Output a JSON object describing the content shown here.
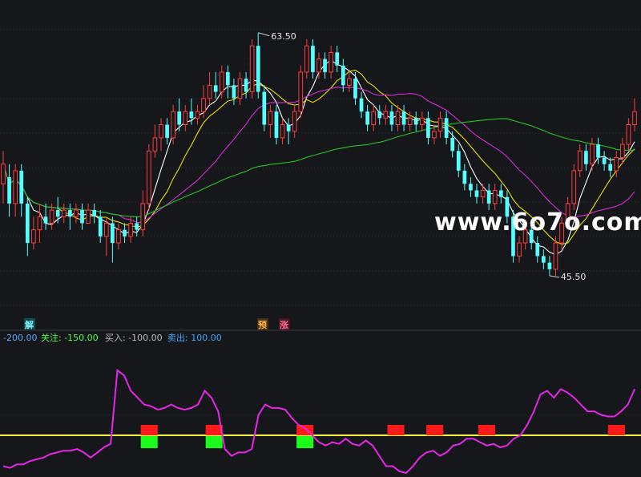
{
  "chart_data": [
    {
      "type": "candlestick",
      "panel": "price",
      "ylim": [
        43,
        66
      ],
      "grid": true,
      "annotations": {
        "high_label": "63.50",
        "low_label": "45.50"
      },
      "badges": [
        "解",
        "预",
        "涨"
      ],
      "watermark": "www.6o7o.com",
      "candles": [
        [
          52.5,
          54,
          55,
          51
        ],
        [
          53,
          51,
          54,
          50
        ],
        [
          51,
          53.5,
          54,
          50
        ],
        [
          53.5,
          51,
          54,
          50
        ],
        [
          51,
          48,
          51.5,
          47
        ],
        [
          48,
          49,
          50,
          47.5
        ],
        [
          49,
          50,
          51,
          48
        ],
        [
          50,
          49.5,
          51,
          49
        ],
        [
          49.5,
          50.5,
          51,
          49
        ],
        [
          50.5,
          50,
          51.5,
          49.5
        ],
        [
          50,
          50.5,
          51,
          49.5
        ],
        [
          50.5,
          50,
          51,
          49
        ],
        [
          50,
          50.5,
          51,
          49.5
        ],
        [
          50.5,
          49.5,
          51,
          49
        ],
        [
          49.5,
          50.5,
          51,
          49.5
        ],
        [
          50.5,
          50,
          51,
          49.5
        ],
        [
          50,
          48.5,
          50.5,
          48
        ],
        [
          48.5,
          49.5,
          50,
          47
        ],
        [
          49.5,
          48,
          50,
          46.5
        ],
        [
          48,
          49,
          49.5,
          47.5
        ],
        [
          49,
          48.5,
          49.5,
          48
        ],
        [
          48.5,
          49.5,
          50,
          48
        ],
        [
          49.5,
          49,
          50,
          48.5
        ],
        [
          49,
          51,
          52,
          48.5
        ],
        [
          51,
          55,
          55.5,
          50.5
        ],
        [
          55,
          56,
          57,
          54.5
        ],
        [
          56,
          57,
          57.5,
          55
        ],
        [
          57,
          56,
          57.5,
          55.5
        ],
        [
          56,
          58,
          58.5,
          55.5
        ],
        [
          58,
          57,
          59,
          56.5
        ],
        [
          57,
          58,
          58.5,
          56.5
        ],
        [
          58,
          57.5,
          59,
          57
        ],
        [
          57.5,
          58,
          58.5,
          57
        ],
        [
          58,
          59,
          60,
          57.5
        ],
        [
          59,
          60,
          61,
          58.5
        ],
        [
          60,
          59.5,
          61,
          59
        ],
        [
          59.5,
          61,
          61.5,
          59
        ],
        [
          61,
          60,
          61.5,
          59
        ],
        [
          60,
          59,
          60.5,
          58.5
        ],
        [
          59,
          60.5,
          61,
          58.5
        ],
        [
          60.5,
          59.5,
          61,
          59
        ],
        [
          59.5,
          63,
          63.5,
          59
        ],
        [
          63,
          59.5,
          64,
          59
        ],
        [
          59.5,
          57,
          60,
          56.5
        ],
        [
          57,
          58,
          58.5,
          56
        ],
        [
          58,
          56,
          58.5,
          55.5
        ],
        [
          56,
          57,
          57.5,
          55.5
        ],
        [
          57,
          56.5,
          57.5,
          55.5
        ],
        [
          56.5,
          58,
          58.5,
          56
        ],
        [
          58,
          61,
          61.5,
          57.5
        ],
        [
          61,
          63,
          63.5,
          60.5
        ],
        [
          63,
          61,
          63.5,
          60.5
        ],
        [
          61,
          62,
          62.5,
          60.5
        ],
        [
          62,
          61,
          62.5,
          60.5
        ],
        [
          61,
          62.5,
          63,
          60.5
        ],
        [
          62.5,
          61.5,
          63,
          61
        ],
        [
          61.5,
          60,
          62,
          59.5
        ],
        [
          60,
          60.5,
          61,
          59.5
        ],
        [
          60.5,
          59,
          61,
          58.5
        ],
        [
          59,
          58,
          59.5,
          57.5
        ],
        [
          58,
          57,
          58.5,
          56.5
        ],
        [
          57,
          58,
          58.5,
          56.5
        ],
        [
          58,
          57.5,
          58.5,
          57
        ],
        [
          57.5,
          58,
          58.5,
          57
        ],
        [
          58,
          57,
          58.5,
          56.5
        ],
        [
          57,
          58,
          58.5,
          56.5
        ],
        [
          58,
          57,
          58.5,
          56.5
        ],
        [
          57,
          57.5,
          58,
          56.5
        ],
        [
          57.5,
          57,
          58,
          56.5
        ],
        [
          57,
          57.5,
          58,
          56.5
        ],
        [
          57.5,
          56,
          58,
          55.5
        ],
        [
          56,
          56.5,
          57,
          55.5
        ],
        [
          56.5,
          57.5,
          58,
          56
        ],
        [
          57.5,
          56,
          58,
          55.5
        ],
        [
          56,
          55,
          56.5,
          54.5
        ],
        [
          55,
          53.5,
          55.5,
          53
        ],
        [
          53.5,
          52.5,
          54,
          52
        ],
        [
          52.5,
          52,
          53,
          51.5
        ],
        [
          52,
          51.5,
          52.5,
          51
        ],
        [
          51.5,
          52,
          52.5,
          51
        ],
        [
          52,
          51,
          52.5,
          50.5
        ],
        [
          51,
          52,
          52.5,
          50.5
        ],
        [
          52,
          51.5,
          52.5,
          51
        ],
        [
          51.5,
          50,
          52,
          49.5
        ],
        [
          50,
          47,
          50.5,
          46.5
        ],
        [
          47,
          48,
          48.5,
          46.5
        ],
        [
          48,
          49,
          49.5,
          47.5
        ],
        [
          49,
          48,
          49.5,
          47.5
        ],
        [
          48,
          47,
          48.5,
          46.5
        ],
        [
          47,
          46.5,
          47.5,
          46
        ],
        [
          46.5,
          46,
          47,
          45.5
        ],
        [
          46,
          48,
          48.5,
          45.5
        ],
        [
          48,
          49.5,
          50,
          47.5
        ],
        [
          49.5,
          51,
          51.5,
          49
        ],
        [
          51,
          53.5,
          54,
          50.5
        ],
        [
          53.5,
          55,
          55.5,
          53
        ],
        [
          55,
          54,
          55.5,
          53.5
        ],
        [
          54,
          55.5,
          56,
          53.5
        ],
        [
          55.5,
          54.5,
          56,
          54
        ],
        [
          54.5,
          54,
          55,
          53.5
        ],
        [
          54,
          53.5,
          54.5,
          53
        ],
        [
          53.5,
          54.5,
          55,
          53
        ],
        [
          54.5,
          55.5,
          56,
          54
        ],
        [
          55.5,
          57,
          57.5,
          55
        ],
        [
          57,
          58,
          59,
          56.5
        ]
      ]
    },
    {
      "type": "line",
      "panel": "indicator",
      "header": [
        "-200.00",
        "关注: -150.00",
        "买入: -100.00",
        "卖出: 100.00"
      ],
      "ylim": [
        -260,
        110
      ],
      "reference_line": -150,
      "values": [
        -240,
        -245,
        -235,
        -235,
        -225,
        -220,
        -215,
        -205,
        -200,
        -195,
        -195,
        -190,
        -200,
        -215,
        -200,
        -185,
        -175,
        40,
        25,
        -20,
        -40,
        -60,
        -65,
        -75,
        -70,
        -60,
        -70,
        -75,
        -70,
        -60,
        -20,
        -40,
        -80,
        -190,
        -210,
        -200,
        -200,
        -190,
        -90,
        -60,
        -70,
        -70,
        -75,
        -100,
        -120,
        -130,
        -150,
        -170,
        -180,
        -170,
        -175,
        -160,
        -175,
        -180,
        -165,
        -180,
        -210,
        -240,
        -240,
        -255,
        -260,
        -240,
        -215,
        -200,
        -195,
        -210,
        -200,
        -180,
        -175,
        -160,
        -160,
        -170,
        -180,
        -175,
        -185,
        -180,
        -160,
        -150,
        -120,
        -80,
        -30,
        -20,
        -40,
        -15,
        -25,
        -40,
        -60,
        -80,
        -80,
        -90,
        -95,
        -95,
        -80,
        -60,
        -15
      ],
      "signals_red": [
        11,
        16,
        23,
        30,
        33,
        37,
        47
      ],
      "signals_green": [
        11,
        16,
        23
      ]
    }
  ]
}
